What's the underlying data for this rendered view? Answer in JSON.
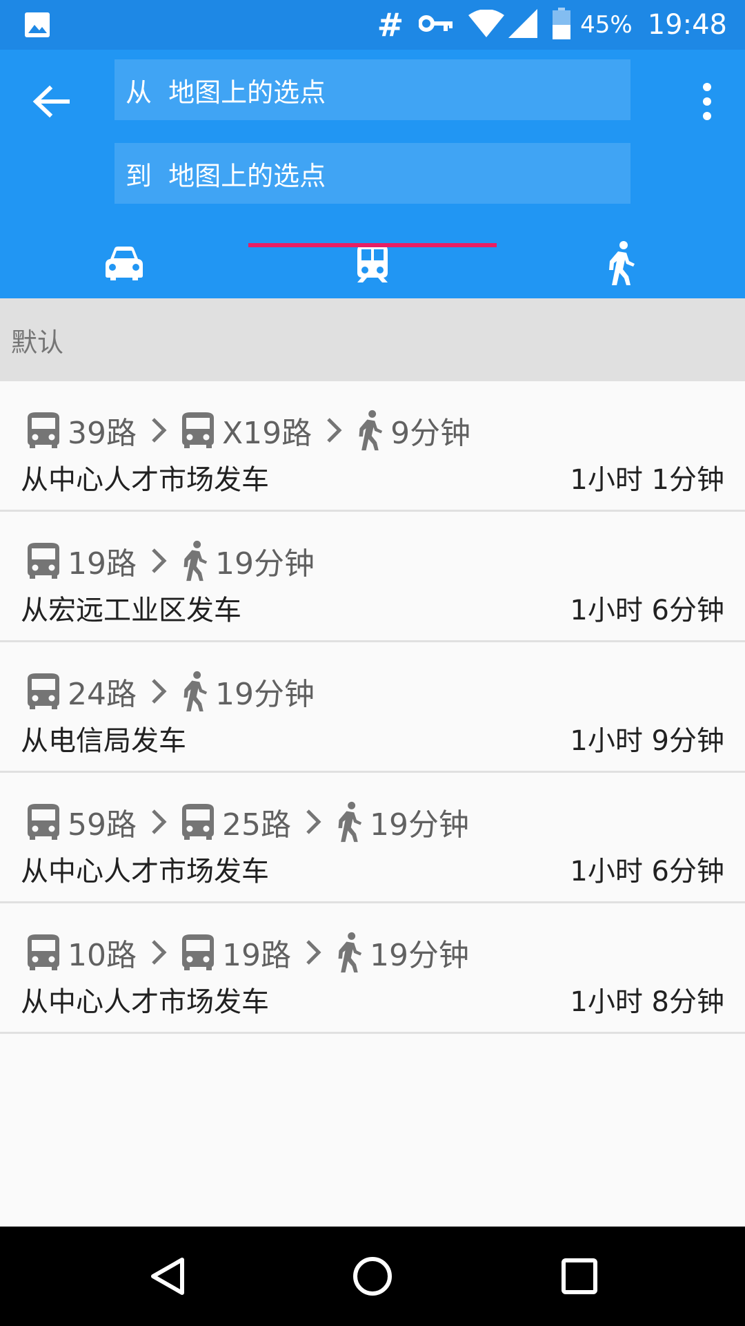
{
  "status_bar": {
    "battery_percent": "45%",
    "time": "19:48",
    "icons": [
      "gallery-icon",
      "hash-icon",
      "vpn-key-icon",
      "wifi-icon",
      "signal-icon",
      "battery-icon"
    ]
  },
  "header": {
    "from_label": "从  地图上的选点",
    "to_label": "到  地图上的选点",
    "tabs": [
      {
        "name": "driving",
        "icon": "car-icon",
        "selected": false
      },
      {
        "name": "transit",
        "icon": "train-icon",
        "selected": true
      },
      {
        "name": "walking",
        "icon": "walk-icon",
        "selected": false
      }
    ]
  },
  "sort": {
    "label": "默认"
  },
  "routes": [
    {
      "segments": [
        {
          "type": "bus",
          "label": "39路"
        },
        {
          "type": "bus",
          "label": "X19路"
        },
        {
          "type": "walk",
          "label": "9分钟"
        }
      ],
      "start": "从中心人才市场发车",
      "duration": "1小时 1分钟"
    },
    {
      "segments": [
        {
          "type": "bus",
          "label": "19路"
        },
        {
          "type": "walk",
          "label": "19分钟"
        }
      ],
      "start": "从宏远工业区发车",
      "duration": "1小时 6分钟"
    },
    {
      "segments": [
        {
          "type": "bus",
          "label": "24路"
        },
        {
          "type": "walk",
          "label": "19分钟"
        }
      ],
      "start": "从电信局发车",
      "duration": "1小时 9分钟"
    },
    {
      "segments": [
        {
          "type": "bus",
          "label": "59路"
        },
        {
          "type": "bus",
          "label": "25路"
        },
        {
          "type": "walk",
          "label": "19分钟"
        }
      ],
      "start": "从中心人才市场发车",
      "duration": "1小时 6分钟"
    },
    {
      "segments": [
        {
          "type": "bus",
          "label": "10路"
        },
        {
          "type": "bus",
          "label": "19路"
        },
        {
          "type": "walk",
          "label": "19分钟"
        }
      ],
      "start": "从中心人才市场发车",
      "duration": "1小时 8分钟"
    }
  ],
  "colors": {
    "status_bar": "#1e88e5",
    "app_bar": "#2196f3",
    "tab_indicator": "#e91e63",
    "sort_bar": "#e0e0e0"
  }
}
